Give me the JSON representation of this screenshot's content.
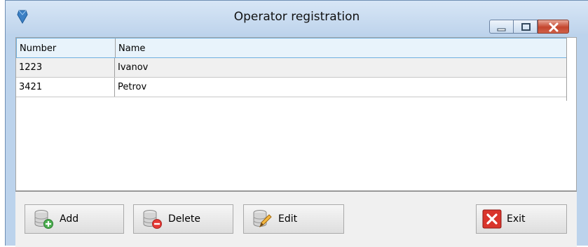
{
  "window": {
    "title": "Operator registration"
  },
  "table": {
    "columns": [
      "Number",
      "Name"
    ],
    "rows": [
      [
        "1223",
        "Ivanov"
      ],
      [
        "3421",
        "Petrov"
      ]
    ]
  },
  "buttons": {
    "add": "Add",
    "delete": "Delete",
    "edit": "Edit",
    "exit": "Exit"
  },
  "icons": {
    "app": "app-gem-icon",
    "add": "database-add-icon",
    "delete": "database-delete-icon",
    "edit": "database-edit-icon",
    "exit": "close-x-icon"
  },
  "colors": {
    "title_bar": "#bfd4ec",
    "header_row": "#e8f3fb",
    "close_button": "#c4452d",
    "exit_icon": "#d9342b"
  }
}
